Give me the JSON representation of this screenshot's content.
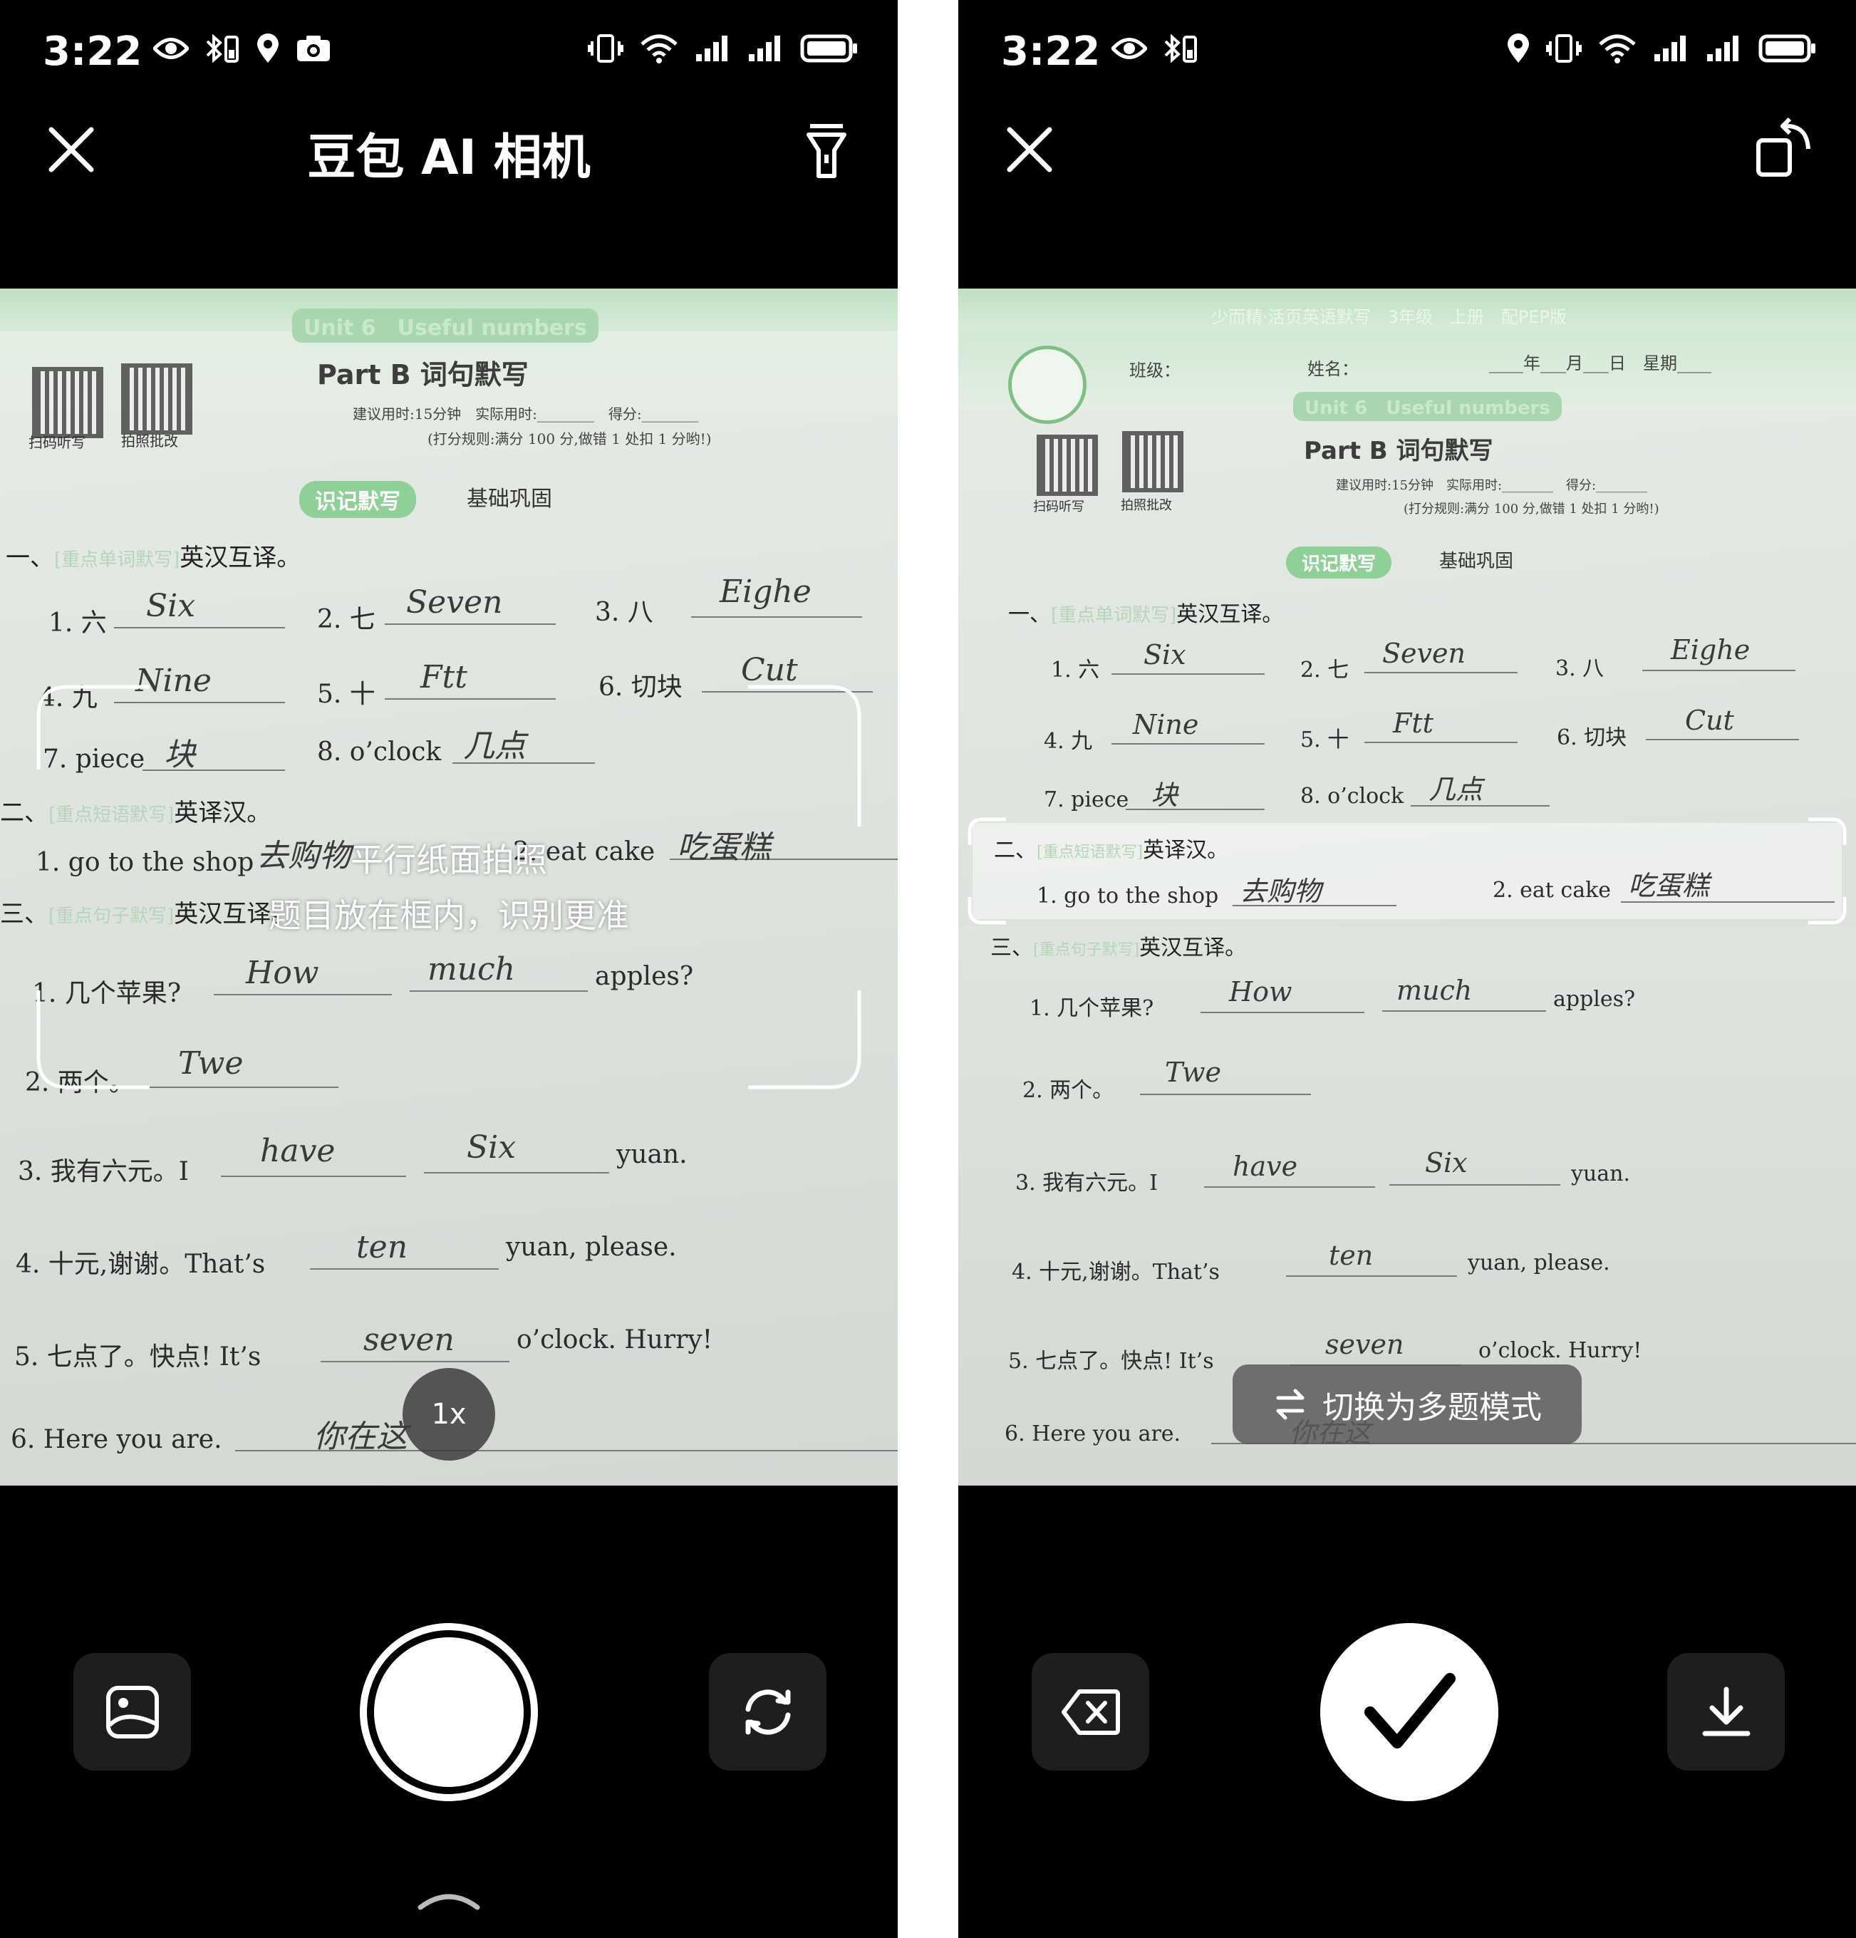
{
  "status": {
    "time": "3:22"
  },
  "left": {
    "title": "豆包 AI 相机",
    "hint_line1": "平行纸面拍照",
    "hint_line2": "题目放在框内，识别更准",
    "zoom_label": "1x"
  },
  "right": {
    "switch_label": "切换为多题模式"
  },
  "paper": {
    "series": "少而精·活页英语默写　3年级　上册　配PEP版",
    "class_label": "班级：",
    "name_label": "姓名：",
    "date_label": "____年___月___日　星期____",
    "unit": "Unit 6　Useful numbers",
    "part_title": "Part B 词句默写",
    "time_line": "建议用时:15分钟　实际用时:________　得分:________",
    "rule_line": "(打分规则:满分 100 分,做错 1 处扣 1 分哟!)",
    "qr1_label": "扫码听写",
    "qr2_label": "拍照批改",
    "badge": "识记默写",
    "badge_sub": "基础巩固",
    "sec1": "一、",
    "sec1_tag": "[重点单词默写]",
    "sec1_title": "英汉互译。",
    "w1": "1. 六",
    "a1": "Six",
    "w2": "2. 七",
    "a2": "Seven",
    "w3": "3. 八",
    "a3": "Eighe",
    "w4": "4. 九",
    "a4": "Nine",
    "w5": "5. 十",
    "a5": "Ftt",
    "w6": "6. 切块",
    "a6": "Cut",
    "w7": "7. piece",
    "a7": "块",
    "w8": "8. o’clock",
    "a8": "几点",
    "sec2": "二、",
    "sec2_tag": "[重点短语默写]",
    "sec2_title": "英译汉。",
    "p1": "1. go to the shop",
    "pa1": "去购物",
    "p2": "2. eat cake",
    "pa2": "吃蛋糕",
    "sec3": "三、",
    "sec3_tag": "[重点句子默写]",
    "sec3_title": "英汉互译。",
    "s1": "1. 几个苹果?",
    "s1a": "How",
    "s1b": "much",
    "s1c": "apples?",
    "s2": "2. 两个。",
    "s2a": "Twe",
    "s3": "3. 我有六元。I",
    "s3a": "have",
    "s3b": "Six",
    "s3c": "yuan.",
    "s4": "4. 十元,谢谢。That’s",
    "s4a": "ten",
    "s4c": "yuan, please.",
    "s5": "5. 七点了。快点! It’s",
    "s5a": "seven",
    "s5c": "o’clock. Hurry!",
    "s6": "6. Here you are.",
    "s6a": "你在这"
  }
}
